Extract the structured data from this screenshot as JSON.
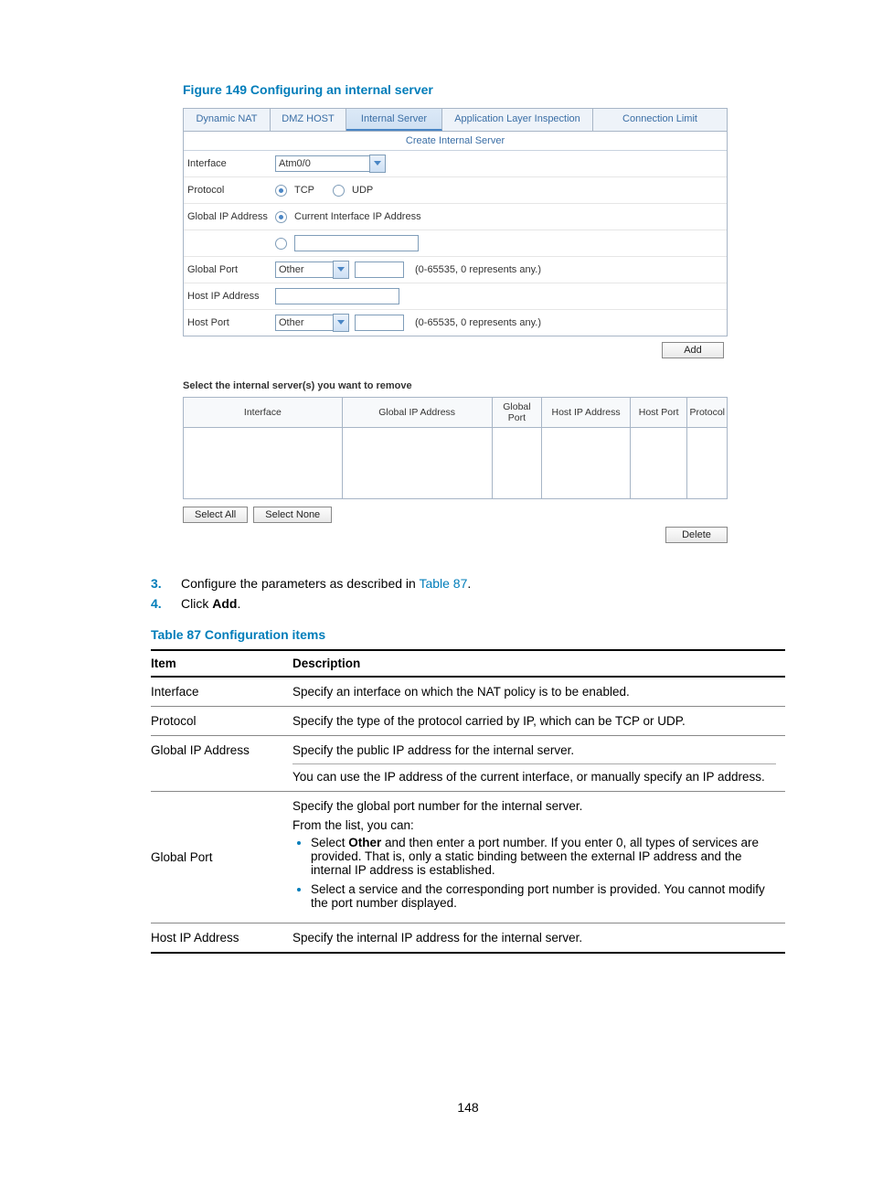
{
  "figure_title": "Figure 149 Configuring an internal server",
  "tabs": [
    "Dynamic NAT",
    "DMZ HOST",
    "Internal Server",
    "Application Layer Inspection",
    "Connection Limit"
  ],
  "section_header": "Create Internal Server",
  "form": {
    "interface_label": "Interface",
    "interface_value": "Atm0/0",
    "protocol_label": "Protocol",
    "protocol_tcp": "TCP",
    "protocol_udp": "UDP",
    "global_ip_label": "Global IP Address",
    "global_ip_current": "Current Interface IP Address",
    "global_port_label": "Global Port",
    "global_port_value": "Other",
    "port_hint": "(0-65535, 0 represents any.)",
    "host_ip_label": "Host IP Address",
    "host_port_label": "Host Port",
    "host_port_value": "Other",
    "add_btn": "Add"
  },
  "remove_caption": "Select the internal server(s) you want to remove",
  "grid_headers": [
    "Interface",
    "Global IP Address",
    "Global Port",
    "Host IP Address",
    "Host Port",
    "Protocol"
  ],
  "select_all": "Select All",
  "select_none": "Select None",
  "delete_btn": "Delete",
  "step3_num": "3.",
  "step3_a": "Configure the parameters as described in ",
  "step3_link": "Table 87",
  "step3_b": ".",
  "step4_num": "4.",
  "step4_a": "Click ",
  "step4_bold": "Add",
  "step4_b": ".",
  "table_caption": "Table 87 Configuration items",
  "thead_item": "Item",
  "thead_desc": "Description",
  "rows": {
    "r1_item": "Interface",
    "r1_desc": "Specify an interface on which the NAT policy is to be enabled.",
    "r2_item": "Protocol",
    "r2_desc": "Specify the type of the protocol carried by IP, which can be TCP or UDP.",
    "r3_item": "Global IP Address",
    "r3_desc_a": "Specify the public IP address for the internal server.",
    "r3_desc_b": "You can use the IP address of the current interface, or manually specify an IP address.",
    "r4_item": "Global Port",
    "r4_p1": "Specify the global port number for the internal server.",
    "r4_p2": "From the list, you can:",
    "r4_b1a": "Select ",
    "r4_b1bold": "Other",
    "r4_b1b": " and then enter a port number. If you enter 0, all types of services are provided. That is, only a static binding between the external IP address and the internal IP address is established.",
    "r4_b2": "Select a service and the corresponding port number is provided. You cannot modify the port number displayed.",
    "r5_item": "Host IP Address",
    "r5_desc": "Specify the internal IP address for the internal server."
  },
  "page_number": "148"
}
